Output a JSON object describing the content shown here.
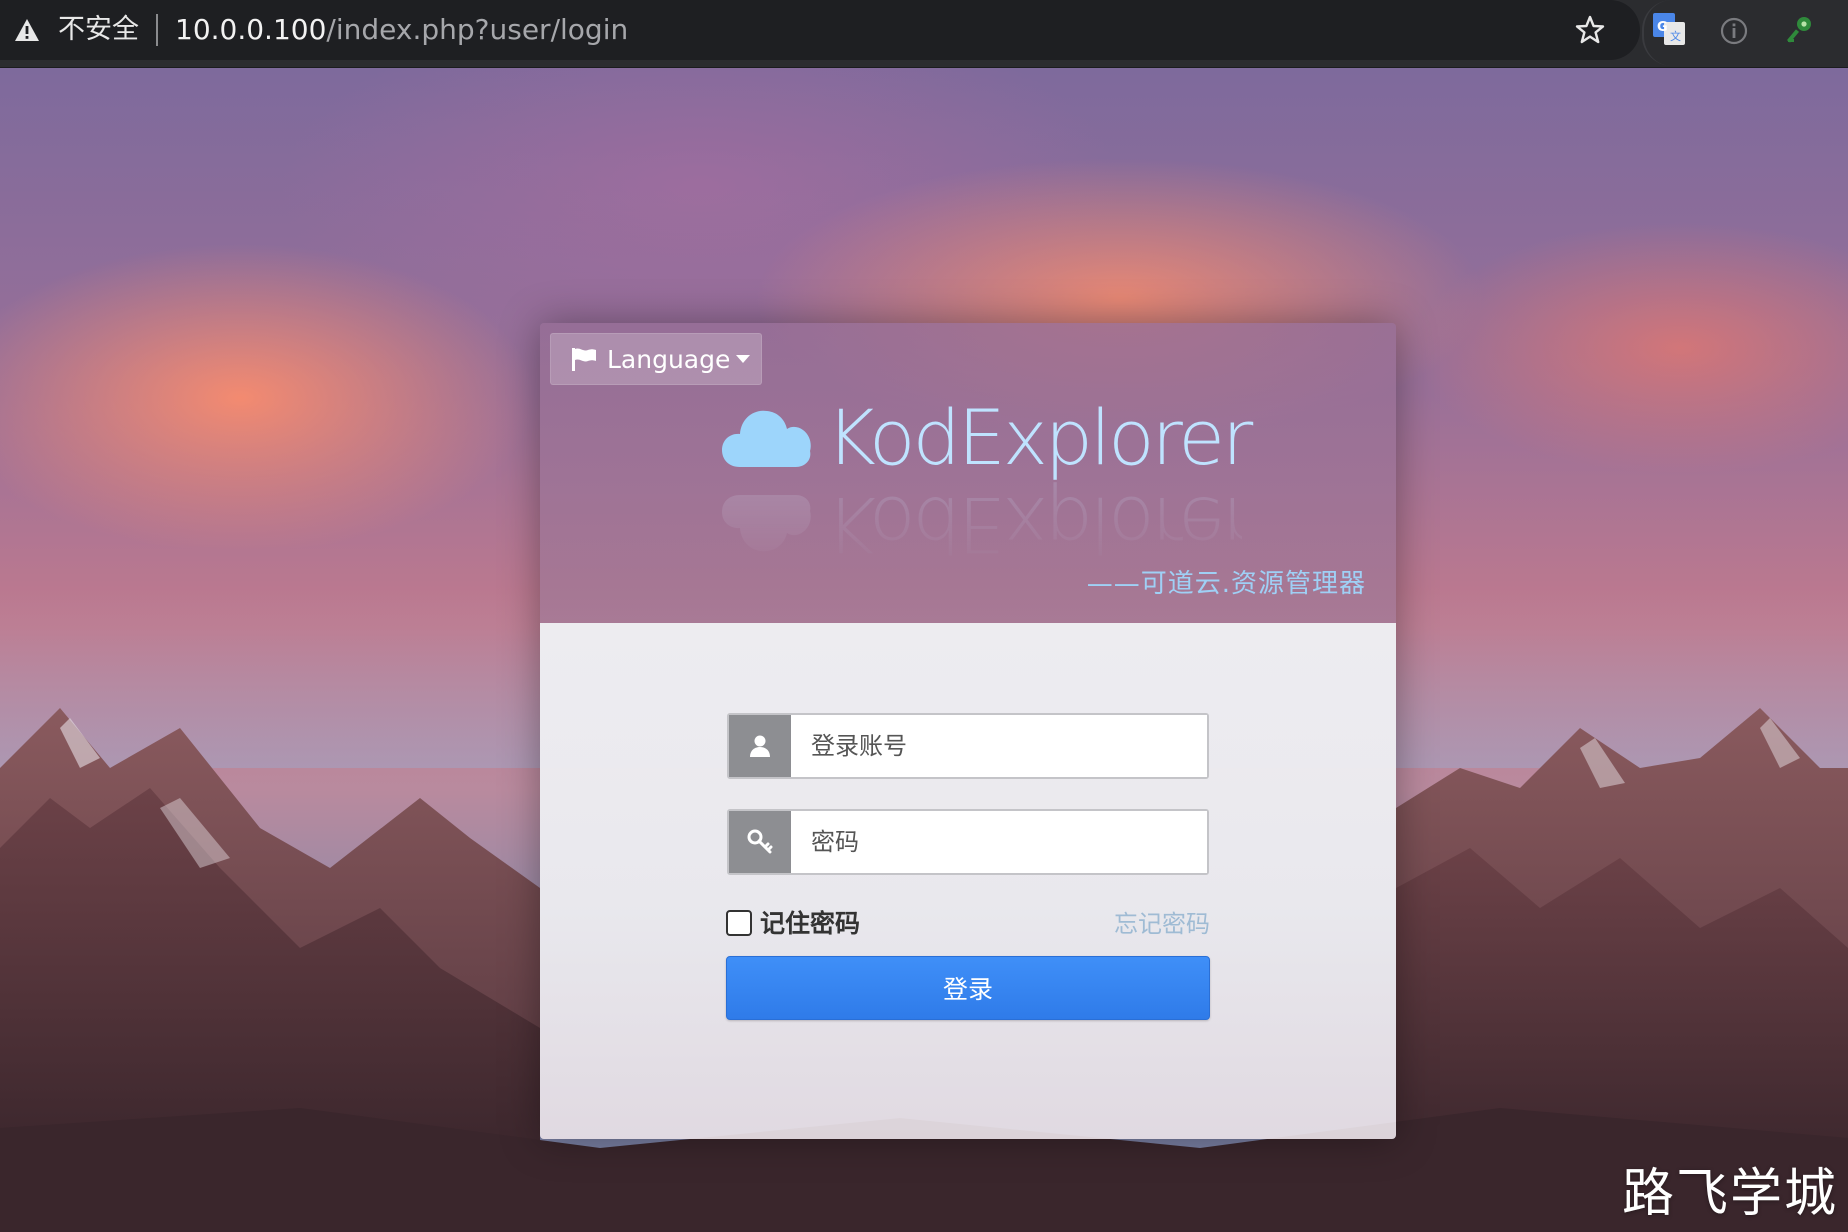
{
  "browser": {
    "security_label": "不安全",
    "url_host": "10.0.0.100",
    "url_path": "/index.php?user/login",
    "icons": [
      "warning-icon",
      "bookmark-star-icon",
      "translate-extension-icon",
      "info-extension-icon",
      "key-extension-icon"
    ]
  },
  "login": {
    "language_label": "Language",
    "app_name": "KodExplorer",
    "tagline": "——可道云.资源管理器",
    "username_placeholder": "登录账号",
    "password_placeholder": "密码",
    "remember_label": "记住密码",
    "remember_checked": false,
    "forgot_label": "忘记密码",
    "submit_label": "登录"
  },
  "watermark": "路飞学城",
  "colors": {
    "accent_blue": "#3585f2",
    "logo_blue": "#bfe3ff",
    "browser_bg": "#1e1f22"
  }
}
